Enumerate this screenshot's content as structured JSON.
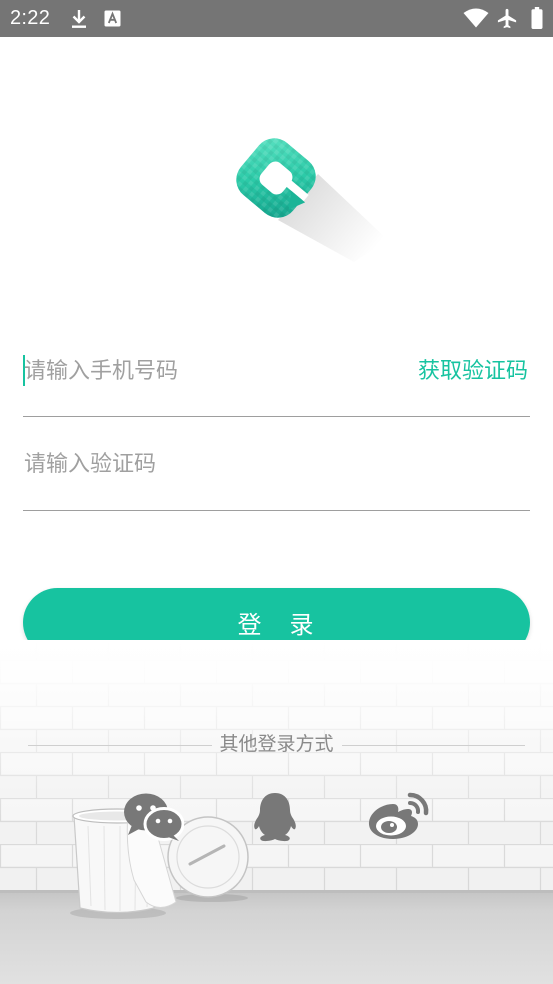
{
  "status_bar": {
    "time": "2:22",
    "icons": [
      "download-icon",
      "text-a-icon",
      "wifi-icon",
      "airplane-mode-icon",
      "battery-icon"
    ]
  },
  "logo": {
    "icon": "app-logo-icon"
  },
  "login_form": {
    "phone": {
      "placeholder": "请输入手机号码",
      "value": ""
    },
    "get_code_label": "获取验证码",
    "code": {
      "placeholder": "请输入验证码",
      "value": ""
    },
    "submit_label": "登　录"
  },
  "other_login": {
    "title": "其他登录方式",
    "methods": [
      {
        "icon": "wechat-icon"
      },
      {
        "icon": "qq-icon"
      },
      {
        "icon": "weibo-icon"
      }
    ]
  },
  "colors": {
    "accent": "#17C3A0",
    "status_bar": "#757575",
    "placeholder": "#A0A0A0",
    "divider": "#9E9E9E",
    "secondary_text": "#8A8A8A",
    "social_icon": "#787878"
  }
}
